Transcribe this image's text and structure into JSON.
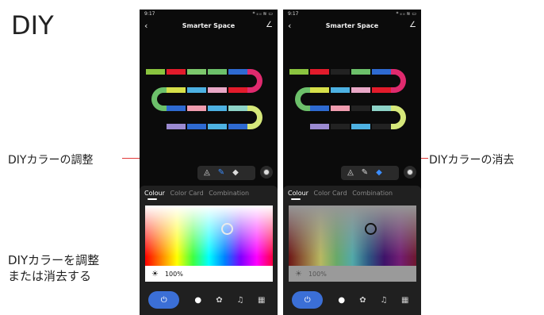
{
  "heading": "DIY",
  "labels": {
    "adjust": "DIYカラーの調整",
    "erase": "DIYカラーの消去",
    "bottom_line1": "DIYカラーを調整",
    "bottom_line2": "または消去する"
  },
  "colors": {
    "callout_line": "#e23a3a",
    "accent": "#3b8dff",
    "power": "#3b6fd6"
  },
  "phones": [
    {
      "status_time": "9:17",
      "status_right": "* ᵢₗ ᵢₗ ≋ ▭",
      "title": "Smarter Space",
      "back_icon": "back-icon",
      "edit_icon": "edit-icon",
      "tools": [
        "bucket-icon",
        "pen-icon",
        "eraser-icon",
        "picker-icon"
      ],
      "selected_tool": "pen-icon",
      "tabs": [
        "Colour",
        "Color Card",
        "Combination"
      ],
      "active_tab": "Colour",
      "brightness": "100%",
      "bottom_bar": [
        "power-icon",
        "bulb-icon",
        "palette-icon",
        "music-icon",
        "grid-icon"
      ]
    },
    {
      "status_time": "9:17",
      "status_right": "* ᵢₗ ᵢₗ ≋ ▭",
      "title": "Smarter Space",
      "back_icon": "back-icon",
      "edit_icon": "edit-icon",
      "tools": [
        "bucket-icon",
        "pen-icon",
        "eraser-icon",
        "picker-icon"
      ],
      "selected_tool": "eraser-icon",
      "tabs": [
        "Colour",
        "Color Card",
        "Combination"
      ],
      "active_tab": "Colour",
      "brightness": "100%",
      "bottom_bar": [
        "power-icon",
        "bulb-icon",
        "palette-icon",
        "music-icon",
        "grid-icon"
      ]
    }
  ]
}
